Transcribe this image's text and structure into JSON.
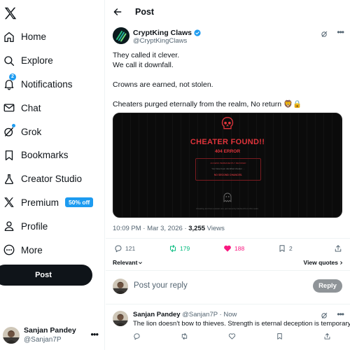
{
  "sidebar": {
    "logo": "x-logo",
    "items": [
      {
        "label": "Home",
        "icon": "home-icon"
      },
      {
        "label": "Explore",
        "icon": "search-icon"
      },
      {
        "label": "Notifications",
        "icon": "bell-icon",
        "badge": "2"
      },
      {
        "label": "Chat",
        "icon": "mail-icon"
      },
      {
        "label": "Grok",
        "icon": "grok-icon"
      },
      {
        "label": "Bookmarks",
        "icon": "bookmark-icon"
      },
      {
        "label": "Creator Studio",
        "icon": "flask-icon"
      },
      {
        "label": "Premium",
        "icon": "x-logo-icon",
        "badge": "50% off"
      },
      {
        "label": "Profile",
        "icon": "person-icon"
      },
      {
        "label": "More",
        "icon": "more-circle-icon"
      }
    ],
    "post_button": "Post",
    "account": {
      "name": "Sanjan Pandey",
      "handle": "@Sanjan7P"
    }
  },
  "header": {
    "title": "Post"
  },
  "tweet": {
    "author_name": "CryptKing Claws",
    "author_handle": "@CryptKingClaws",
    "lines": [
      "They called it clever.",
      "We call it downfall.",
      "Crowns are earned, not stolen.",
      "Cheaters purged eternally from the realm, No return 🦁🔒"
    ],
    "media": {
      "headline": "CHEATER FOUND!!",
      "code": "404 ERROR",
      "notice_1": "ACCESS PERMANENTLY REVOKED",
      "notice_2": "You have been identified cheater …",
      "notice_3": "NO SECOND CHANCES.",
      "footer": "Cheating and ban evasion are permanently blocked from this realm."
    },
    "time": "10:09 PM · Mar 3, 2026 ·",
    "views_count": "3,255",
    "views_label": "Views",
    "stats": {
      "replies": "121",
      "reposts": "179",
      "likes": "188",
      "bookmarks": "2"
    },
    "relevant": "Relevant",
    "view_quotes": "View quotes"
  },
  "reply_box": {
    "placeholder": "Post your reply",
    "button": "Reply"
  },
  "reply": {
    "name": "Sanjan Pandey",
    "meta": "@Sanjan7P · Now",
    "text": "The lion doesn't bow to thieves. Strength is eternal deception is temporary."
  },
  "colors": {
    "accent": "#1d9bf0",
    "repost": "#00ba7c",
    "like": "#f91880",
    "alert": "#e0343b"
  }
}
